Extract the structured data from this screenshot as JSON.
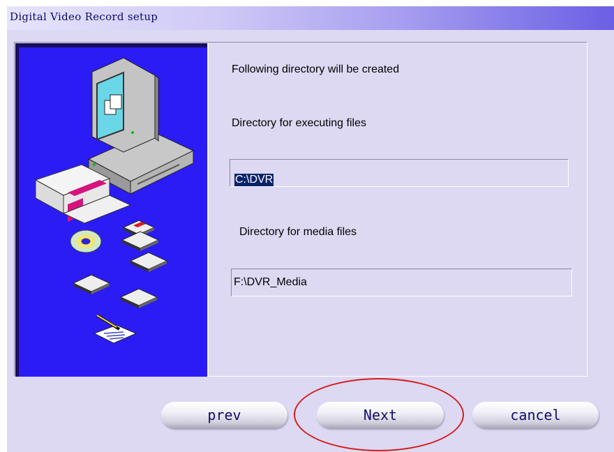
{
  "window": {
    "title": "Digital Video Record setup"
  },
  "content": {
    "heading": "Following directory will be created",
    "exec_label": "Directory for executing files",
    "exec_value": "C:\\DVR",
    "media_label": "Directory for media files",
    "media_value": "F:\\DVR_Media"
  },
  "buttons": {
    "prev": "prev",
    "next": "Next",
    "cancel": "cancel"
  },
  "colors": {
    "title_text": "#0b0b6a",
    "art_background": "#2b1cf6",
    "window_background": "#ddd9f3",
    "selection": "#0a246a",
    "annotation_circle": "#d51c1c"
  },
  "icons": [
    "computer-icon",
    "software-box-icon",
    "floppy-disk-icon",
    "cd-icon",
    "pen-paper-icon"
  ]
}
